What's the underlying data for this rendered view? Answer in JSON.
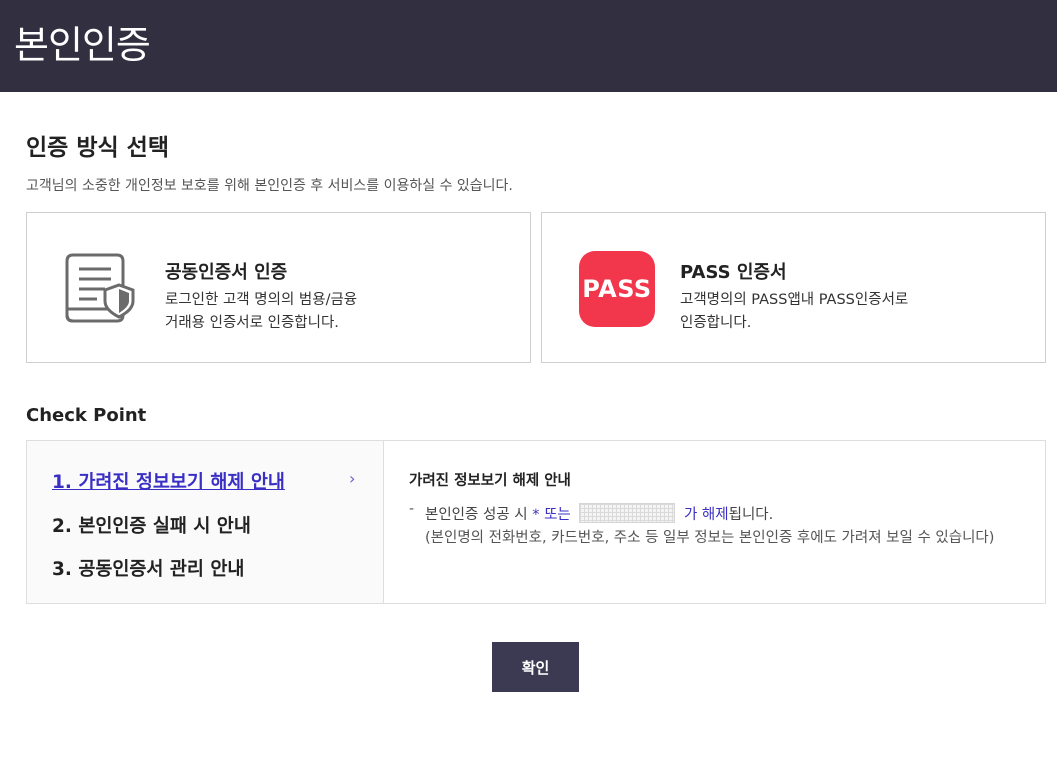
{
  "header": {
    "title": "본인인증"
  },
  "method": {
    "title": "인증 방식 선택",
    "description": "고객님의 소중한 개인정보 보호를 위해 본인인증 후 서비스를 이용하실 수 있습니다.",
    "options": [
      {
        "icon": "certificate-icon",
        "title": "공동인증서 인증",
        "desc_line1": "로그인한 고객 명의의 범용/금융",
        "desc_line2": "거래용 인증서로 인증합니다."
      },
      {
        "icon": "pass-logo",
        "logo_text": "PASS",
        "title": "PASS 인증서",
        "desc_line1": "고객명의의 PASS앱내 PASS인증서로",
        "desc_line2": "인증합니다."
      }
    ]
  },
  "checkpoint": {
    "title": "Check Point",
    "items": [
      {
        "label": "1. 가려진 정보보기 해제 안내",
        "active": true
      },
      {
        "label": "2. 본인인증 실패 시 안내",
        "active": false
      },
      {
        "label": "3. 공동인증서 관리 안내",
        "active": false
      }
    ],
    "chevron": "›",
    "detail": {
      "title": "가려진 정보보기 해제 안내",
      "bullet": "-",
      "line1_prefix": "본인인증 성공 시",
      "line1_highlight1": "* 또는",
      "line1_highlight2": "가 해제",
      "line1_suffix": "됩니다.",
      "line2": "(본인명의 전화번호, 카드번호, 주소 등 일부 정보는 본인인증 후에도 가려져 보일 수 있습니다)"
    }
  },
  "confirm_button": {
    "label": "확인"
  },
  "colors": {
    "header_bg": "#322f40",
    "accent": "#3a2fc5",
    "pass_red": "#f2364b",
    "button_bg": "#3c3952"
  }
}
